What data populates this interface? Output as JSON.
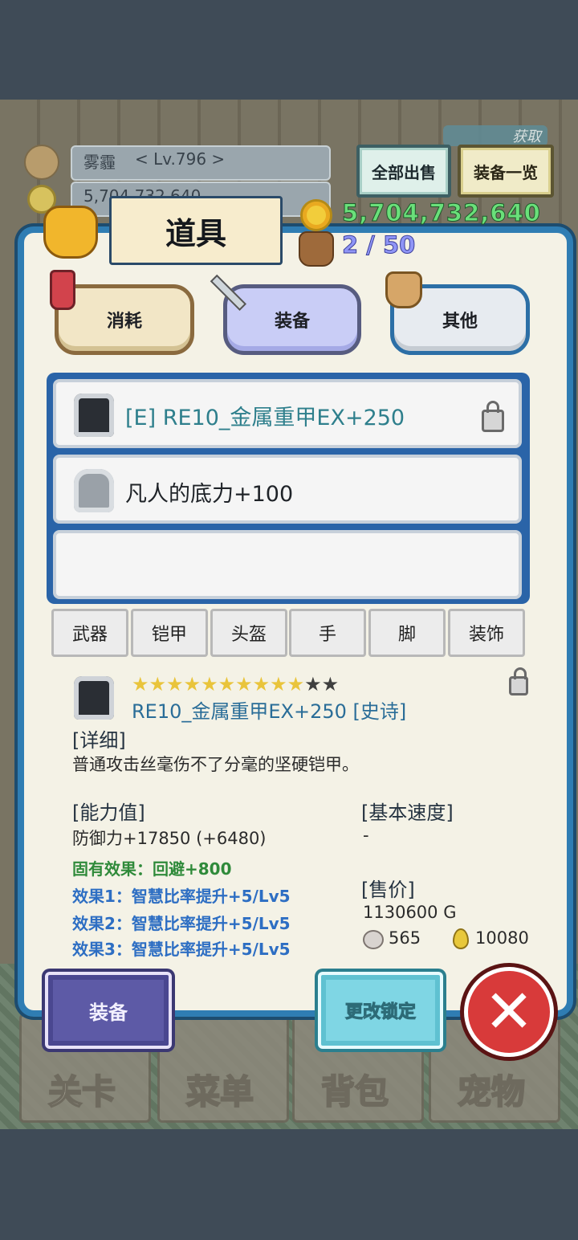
{
  "header": {
    "player_name": "雾霾",
    "player_level": "< Lv.796 >",
    "gold_small": "5,704,732,640",
    "sell_all_label": "全部出售",
    "equip_list_label": "装备一览",
    "obtain_label": "获取"
  },
  "panel": {
    "title": "道具",
    "gold": "5,704,732,640",
    "capacity": "2 / 50"
  },
  "tabs": {
    "consume": "消耗",
    "equip": "装备",
    "other": "其他"
  },
  "items": [
    {
      "label": "[E] RE10_金属重甲EX+250",
      "icon": "armor-icon",
      "locked": true
    },
    {
      "label": "凡人的底力+100",
      "icon": "helmet-icon",
      "locked": false
    }
  ],
  "categories": [
    "武器",
    "铠甲",
    "头盔",
    "手",
    "脚",
    "装饰"
  ],
  "detail": {
    "stars_total": 12,
    "stars_filled": 10,
    "name": "RE10_金属重甲EX+250 [史诗]",
    "detail_header": "[详细]",
    "description": "普通攻击丝毫伤不了分毫的坚硬铠甲。",
    "ability_header": "[能力值]",
    "defense": "防御力+17850 (+6480)",
    "inherent": "固有效果：回避+800",
    "effect1": "效果1：智慧比率提升+5/Lv5",
    "effect2": "效果2：智慧比率提升+5/Lv5",
    "effect3": "效果3：智慧比率提升+5/Lv5",
    "speed_header": "[基本速度]",
    "speed_value": "-",
    "price_header": "[售价]",
    "price": "1130600 G",
    "stone_count": "565",
    "drop_count": "10080"
  },
  "actions": {
    "equip": "装备",
    "change_lock": "更改锁定"
  },
  "bottom_nav": [
    "关卡",
    "菜单",
    "背包",
    "宠物"
  ],
  "colors": {
    "panel_border": "#2f7db3",
    "gold_text": "#6ae07a",
    "capacity_text": "#8f95f6",
    "item_name": "#2a6d98",
    "inherent_effect": "#2f8a3a",
    "effect_text": "#2d6ec3",
    "close_button": "#d83a3a"
  }
}
